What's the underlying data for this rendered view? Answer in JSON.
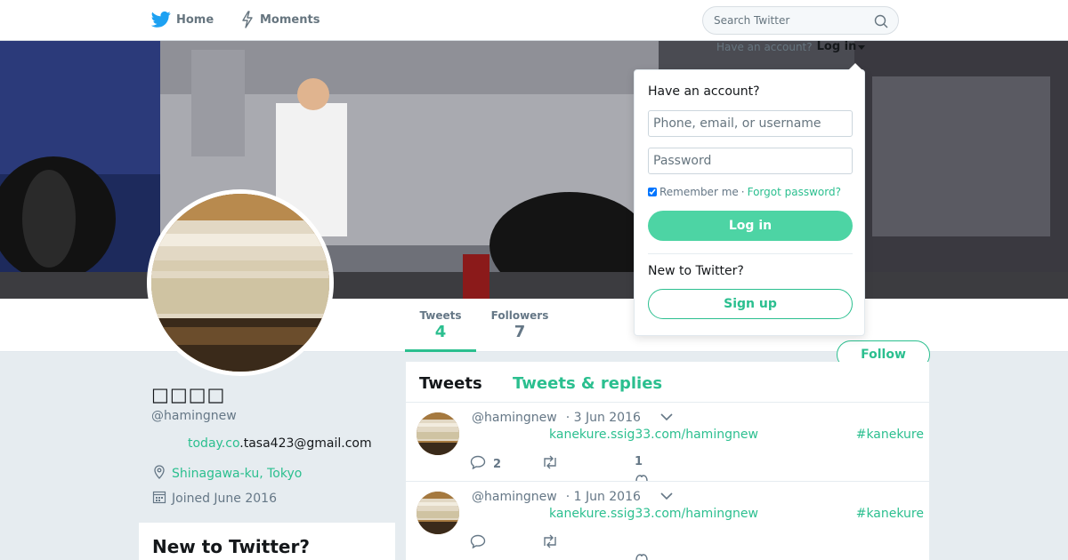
{
  "colors": {
    "accent": "#2bbf8f",
    "text": "#14171a",
    "muted": "#657786",
    "background": "#e6ecf0"
  },
  "nav": {
    "home_label": "Home",
    "home_icon": "twitter-bird-icon",
    "moments_label": "Moments",
    "moments_icon": "lightning-icon",
    "search_placeholder": "Search Twitter",
    "search_icon": "search-icon",
    "account_prompt": "Have an account?",
    "login_label": "Log in"
  },
  "login_dropdown": {
    "title": "Have an account?",
    "username_placeholder": "Phone, email, or username",
    "password_placeholder": "Password",
    "remember_label": "Remember me",
    "separator": "·",
    "forgot_label": "Forgot password?",
    "login_button": "Log in",
    "new_prompt": "New to Twitter?",
    "signup_button": "Sign up"
  },
  "profile_nav": {
    "tweets_label": "Tweets",
    "tweets_count": "4",
    "followers_label": "Followers",
    "followers_count": "7",
    "follow_button": "Follow"
  },
  "profile": {
    "name": "□□□□",
    "handle": "@hamingnew",
    "bio_link": "today.co",
    "bio_rest": ".tasa423@gmail.com",
    "location": "Shinagawa-ku, Tokyo",
    "location_icon": "location-pin-icon",
    "joined": "Joined June 2016",
    "joined_icon": "calendar-icon"
  },
  "new_to_twitter": {
    "title": "New to Twitter?"
  },
  "timeline": {
    "tabs": [
      "Tweets",
      "Tweets & replies"
    ],
    "tweets": [
      {
        "handle": "@hamingnew",
        "date": "· 3 Jun 2016",
        "link": "kanekure.ssig33.com/hamingnew",
        "hashtag": "#kanekure",
        "replies": "2",
        "retweets": "",
        "likes": "1"
      },
      {
        "handle": "@hamingnew",
        "date": "· 1 Jun 2016",
        "link": "kanekure.ssig33.com/hamingnew",
        "hashtag": "#kanekure",
        "replies": "",
        "retweets": "",
        "likes": ""
      }
    ]
  }
}
